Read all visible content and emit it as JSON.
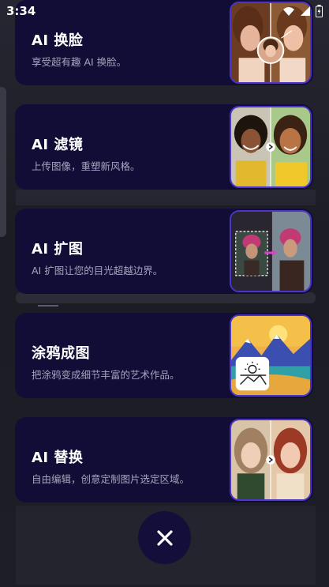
{
  "status_bar": {
    "time": "3:34"
  },
  "cards": [
    {
      "title": "AI 换脸",
      "description": "享受超有趣 AI 换脸。"
    },
    {
      "title": "AI 滤镜",
      "description": "上传图像，重塑新风格。"
    },
    {
      "title": "AI 扩图",
      "description": "AI 扩图让您的目光超越边界。"
    },
    {
      "title": "涂鸦成图",
      "description": "把涂鸦变成细节丰富的艺术作品。"
    },
    {
      "title": "AI 替换",
      "description": "自由编辑，创意定制图片选定区域。"
    }
  ],
  "colors": {
    "card_bg": "#120d36",
    "accent_border": "#4b36c9",
    "description": "#a7a4bc"
  },
  "icons": [
    "wifi-icon",
    "signal-icon",
    "battery-icon",
    "close-icon",
    "image-icon",
    "chevron-right-icon"
  ]
}
